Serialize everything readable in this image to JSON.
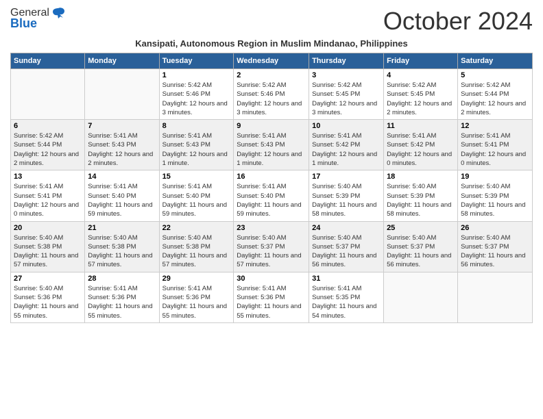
{
  "logo": {
    "general": "General",
    "blue": "Blue"
  },
  "title": "October 2024",
  "subtitle": "Kansipati, Autonomous Region in Muslim Mindanao, Philippines",
  "headers": [
    "Sunday",
    "Monday",
    "Tuesday",
    "Wednesday",
    "Thursday",
    "Friday",
    "Saturday"
  ],
  "weeks": [
    {
      "days": [
        {
          "num": "",
          "info": "",
          "empty": true
        },
        {
          "num": "",
          "info": "",
          "empty": true
        },
        {
          "num": "1",
          "info": "Sunrise: 5:42 AM\nSunset: 5:46 PM\nDaylight: 12 hours and 3 minutes."
        },
        {
          "num": "2",
          "info": "Sunrise: 5:42 AM\nSunset: 5:46 PM\nDaylight: 12 hours and 3 minutes."
        },
        {
          "num": "3",
          "info": "Sunrise: 5:42 AM\nSunset: 5:45 PM\nDaylight: 12 hours and 3 minutes."
        },
        {
          "num": "4",
          "info": "Sunrise: 5:42 AM\nSunset: 5:45 PM\nDaylight: 12 hours and 2 minutes."
        },
        {
          "num": "5",
          "info": "Sunrise: 5:42 AM\nSunset: 5:44 PM\nDaylight: 12 hours and 2 minutes."
        }
      ]
    },
    {
      "days": [
        {
          "num": "6",
          "info": "Sunrise: 5:42 AM\nSunset: 5:44 PM\nDaylight: 12 hours and 2 minutes."
        },
        {
          "num": "7",
          "info": "Sunrise: 5:41 AM\nSunset: 5:43 PM\nDaylight: 12 hours and 2 minutes."
        },
        {
          "num": "8",
          "info": "Sunrise: 5:41 AM\nSunset: 5:43 PM\nDaylight: 12 hours and 1 minute."
        },
        {
          "num": "9",
          "info": "Sunrise: 5:41 AM\nSunset: 5:43 PM\nDaylight: 12 hours and 1 minute."
        },
        {
          "num": "10",
          "info": "Sunrise: 5:41 AM\nSunset: 5:42 PM\nDaylight: 12 hours and 1 minute."
        },
        {
          "num": "11",
          "info": "Sunrise: 5:41 AM\nSunset: 5:42 PM\nDaylight: 12 hours and 0 minutes."
        },
        {
          "num": "12",
          "info": "Sunrise: 5:41 AM\nSunset: 5:41 PM\nDaylight: 12 hours and 0 minutes."
        }
      ]
    },
    {
      "days": [
        {
          "num": "13",
          "info": "Sunrise: 5:41 AM\nSunset: 5:41 PM\nDaylight: 12 hours and 0 minutes."
        },
        {
          "num": "14",
          "info": "Sunrise: 5:41 AM\nSunset: 5:40 PM\nDaylight: 11 hours and 59 minutes."
        },
        {
          "num": "15",
          "info": "Sunrise: 5:41 AM\nSunset: 5:40 PM\nDaylight: 11 hours and 59 minutes."
        },
        {
          "num": "16",
          "info": "Sunrise: 5:41 AM\nSunset: 5:40 PM\nDaylight: 11 hours and 59 minutes."
        },
        {
          "num": "17",
          "info": "Sunrise: 5:40 AM\nSunset: 5:39 PM\nDaylight: 11 hours and 58 minutes."
        },
        {
          "num": "18",
          "info": "Sunrise: 5:40 AM\nSunset: 5:39 PM\nDaylight: 11 hours and 58 minutes."
        },
        {
          "num": "19",
          "info": "Sunrise: 5:40 AM\nSunset: 5:39 PM\nDaylight: 11 hours and 58 minutes."
        }
      ]
    },
    {
      "days": [
        {
          "num": "20",
          "info": "Sunrise: 5:40 AM\nSunset: 5:38 PM\nDaylight: 11 hours and 57 minutes."
        },
        {
          "num": "21",
          "info": "Sunrise: 5:40 AM\nSunset: 5:38 PM\nDaylight: 11 hours and 57 minutes."
        },
        {
          "num": "22",
          "info": "Sunrise: 5:40 AM\nSunset: 5:38 PM\nDaylight: 11 hours and 57 minutes."
        },
        {
          "num": "23",
          "info": "Sunrise: 5:40 AM\nSunset: 5:37 PM\nDaylight: 11 hours and 57 minutes."
        },
        {
          "num": "24",
          "info": "Sunrise: 5:40 AM\nSunset: 5:37 PM\nDaylight: 11 hours and 56 minutes."
        },
        {
          "num": "25",
          "info": "Sunrise: 5:40 AM\nSunset: 5:37 PM\nDaylight: 11 hours and 56 minutes."
        },
        {
          "num": "26",
          "info": "Sunrise: 5:40 AM\nSunset: 5:37 PM\nDaylight: 11 hours and 56 minutes."
        }
      ]
    },
    {
      "days": [
        {
          "num": "27",
          "info": "Sunrise: 5:40 AM\nSunset: 5:36 PM\nDaylight: 11 hours and 55 minutes."
        },
        {
          "num": "28",
          "info": "Sunrise: 5:41 AM\nSunset: 5:36 PM\nDaylight: 11 hours and 55 minutes."
        },
        {
          "num": "29",
          "info": "Sunrise: 5:41 AM\nSunset: 5:36 PM\nDaylight: 11 hours and 55 minutes."
        },
        {
          "num": "30",
          "info": "Sunrise: 5:41 AM\nSunset: 5:36 PM\nDaylight: 11 hours and 55 minutes."
        },
        {
          "num": "31",
          "info": "Sunrise: 5:41 AM\nSunset: 5:35 PM\nDaylight: 11 hours and 54 minutes."
        },
        {
          "num": "",
          "info": "",
          "empty": true
        },
        {
          "num": "",
          "info": "",
          "empty": true
        }
      ]
    }
  ]
}
